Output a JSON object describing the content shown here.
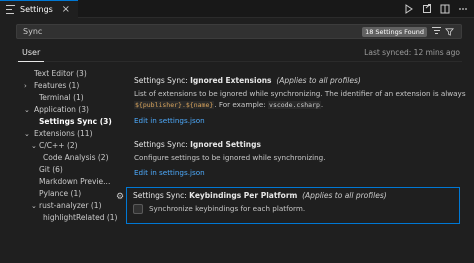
{
  "tab": {
    "title": "Settings",
    "close": "×"
  },
  "search": {
    "value": "Sync",
    "results_badge": "18 Settings Found"
  },
  "scope": {
    "user_tab": "User",
    "last_synced": "Last synced: 12 mins ago"
  },
  "toc": {
    "items": [
      {
        "label": "Text Editor (3)"
      },
      {
        "label": "Features (1)"
      },
      {
        "label": "Terminal (1)"
      },
      {
        "label": "Application (3)"
      },
      {
        "label": "Settings Sync (3)"
      },
      {
        "label": "Extensions (11)"
      },
      {
        "label": "C/C++ (2)"
      },
      {
        "label": "Code Analysis (2)"
      },
      {
        "label": "Git (6)"
      },
      {
        "label": "Markdown Previe..."
      },
      {
        "label": "Pylance (1)"
      },
      {
        "label": "rust-analyzer (1)"
      },
      {
        "label": "highlightRelated (1)"
      }
    ]
  },
  "settings": [
    {
      "prefix": "Settings Sync: ",
      "name": "Ignored Extensions",
      "scope_note": "(Applies to all profiles)",
      "desc_1": "List of extensions to be ignored while synchronizing. The identifier of an extension is always",
      "code_1": "${publisher}.${name}",
      "desc_2": ". For example:",
      "code_2": "vscode.csharp",
      "desc_3": ".",
      "link": "Edit in settings.json"
    },
    {
      "prefix": "Settings Sync: ",
      "name": "Ignored Settings",
      "scope_note": "",
      "desc_1": "Configure settings to be ignored while synchronizing.",
      "link": "Edit in settings.json"
    },
    {
      "prefix": "Settings Sync: ",
      "name": "Keybindings Per Platform",
      "scope_note": "(Applies to all profiles)",
      "desc_1": "Synchronize keybindings for each platform.",
      "checked": false
    }
  ]
}
